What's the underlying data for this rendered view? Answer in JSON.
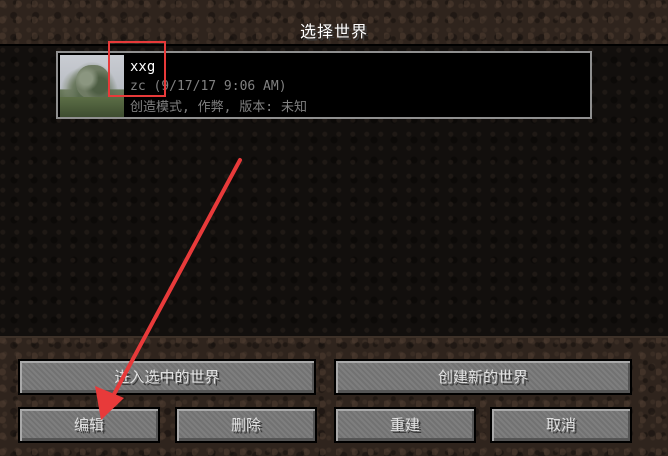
{
  "screen": {
    "title": "选择世界"
  },
  "world_list": {
    "items": [
      {
        "name": "xxg",
        "meta": "zc (9/17/17 9:06 AM)",
        "mode": "创造模式, 作弊, 版本: 未知"
      }
    ]
  },
  "buttons": {
    "play_selected": "进入选中的世界",
    "create_new": "创建新的世界",
    "edit": "编辑",
    "delete": "删除",
    "recreate": "重建",
    "cancel": "取消"
  },
  "annotation": {
    "highlight_color": "#e83a3a"
  }
}
